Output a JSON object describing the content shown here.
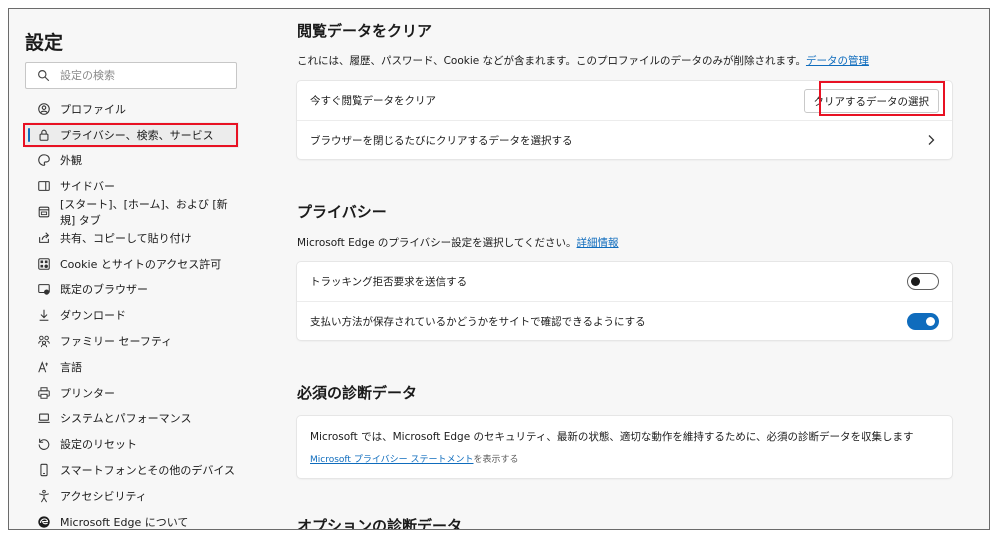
{
  "sidebar": {
    "title": "設定",
    "search_placeholder": "設定の検索",
    "items": [
      {
        "label": "プロファイル",
        "icon": "profile-icon"
      },
      {
        "label": "プライバシー、検索、サービス",
        "icon": "lock-icon",
        "active": true
      },
      {
        "label": "外観",
        "icon": "appearance-icon"
      },
      {
        "label": "サイドバー",
        "icon": "sidebar-icon"
      },
      {
        "label": "[スタート]、[ホーム]、および [新規] タブ",
        "icon": "start-home-icon"
      },
      {
        "label": "共有、コピーして貼り付け",
        "icon": "share-icon"
      },
      {
        "label": "Cookie とサイトのアクセス許可",
        "icon": "cookie-permissions-icon"
      },
      {
        "label": "既定のブラウザー",
        "icon": "default-browser-icon"
      },
      {
        "label": "ダウンロード",
        "icon": "download-icon"
      },
      {
        "label": "ファミリー セーフティ",
        "icon": "family-icon"
      },
      {
        "label": "言語",
        "icon": "language-icon"
      },
      {
        "label": "プリンター",
        "icon": "printer-icon"
      },
      {
        "label": "システムとパフォーマンス",
        "icon": "system-icon"
      },
      {
        "label": "設定のリセット",
        "icon": "reset-icon"
      },
      {
        "label": "スマートフォンとその他のデバイス",
        "icon": "phone-icon"
      },
      {
        "label": "アクセシビリティ",
        "icon": "accessibility-icon"
      },
      {
        "label": "Microsoft Edge について",
        "icon": "edge-icon"
      }
    ]
  },
  "clear_data": {
    "title": "閲覧データをクリア",
    "description": "これには、履歴、パスワード、Cookie などが含まれます。このプロファイルのデータのみが削除されます。",
    "manage_link": "データの管理",
    "row_clear_now": "今すぐ閲覧データをクリア",
    "choose_button": "クリアするデータの選択",
    "row_on_close": "ブラウザーを閉じるたびにクリアするデータを選択する"
  },
  "privacy": {
    "title": "プライバシー",
    "description": "Microsoft Edge のプライバシー設定を選択してください。",
    "details_link": "詳細情報",
    "row_tracking": "トラッキング拒否要求を送信する",
    "tracking_enabled": false,
    "row_payment": "支払い方法が保存されているかどうかをサイトで確認できるようにする",
    "payment_enabled": true
  },
  "diagnostics": {
    "title": "必須の診断データ",
    "text": "Microsoft では、Microsoft Edge のセキュリティ、最新の状態、適切な動作を維持するために、必須の診断データを収集します",
    "link": "Microsoft プライバシー ステートメント",
    "link_suffix": "を表示する"
  },
  "optional": {
    "title": "オプションの診断データ"
  },
  "colors": {
    "accent": "#0f6cbd",
    "highlight": "#e81123"
  }
}
